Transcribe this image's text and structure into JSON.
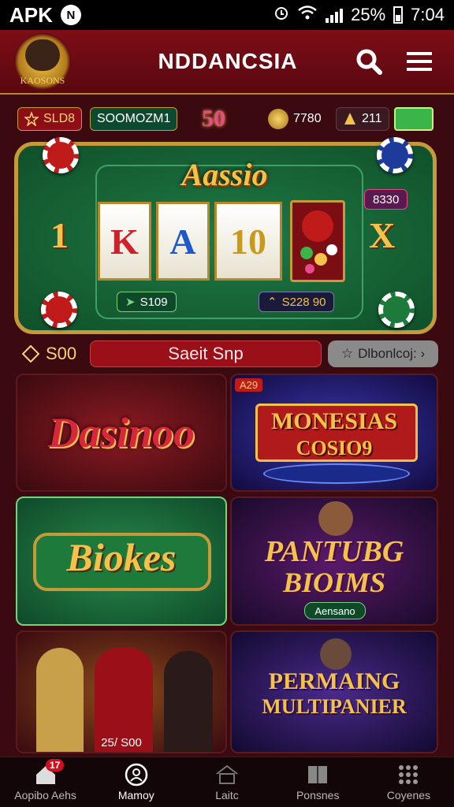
{
  "status_bar": {
    "carrier": "APK",
    "badge": "N",
    "battery": "25%",
    "time": "7:04"
  },
  "header": {
    "logo_text": "KAOSONS",
    "title": "NDDANCSIA"
  },
  "stats": {
    "left_value": "SLD8",
    "center_value": "SOOMOZM1",
    "highlight": "50",
    "coins": "7780",
    "gems": "211"
  },
  "slot": {
    "title": "Aassio",
    "left_number": "1",
    "reels": [
      "K",
      "A",
      "10"
    ],
    "right_symbol": "X",
    "side_value": "8330",
    "bet_value": "S109",
    "win_value": "S228 90"
  },
  "spin_row": {
    "balance": "S00",
    "spin_label": "Saeit Snp",
    "discount_label": "Dlbonlcoj: ›"
  },
  "tiles": {
    "casino_text": "Dasinoo",
    "monesias_badge": "A29",
    "monesias_line1": "MONESIAS",
    "monesias_line2": "COSIO9",
    "biokes_text": "Biokes",
    "pantubg_line1": "PANTUBG",
    "pantubg_line2": "BIOIMS",
    "pantubg_button": "Aensano",
    "dealers_caption": "25/ S00",
    "permaing_line1": "PERMAING",
    "permaing_line2": "MULTIPANIER"
  },
  "nav": {
    "items": [
      {
        "label": "Aopibo Aehs",
        "badge": "17"
      },
      {
        "label": "Mamoy"
      },
      {
        "label": "Laitc"
      },
      {
        "label": "Ponsnes"
      },
      {
        "label": "Coyenes"
      }
    ]
  },
  "colors": {
    "header_bg": "#7d0e17",
    "felt": "#1f7a45",
    "gold": "#c49a3a"
  }
}
